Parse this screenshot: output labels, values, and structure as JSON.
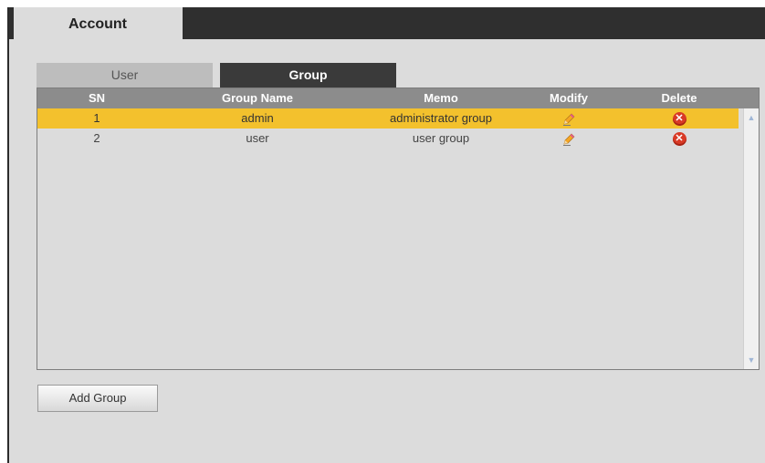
{
  "header": {
    "account_tab": "Account"
  },
  "subtabs": {
    "user": "User",
    "group": "Group"
  },
  "table": {
    "columns": {
      "sn": "SN",
      "group_name": "Group Name",
      "memo": "Memo",
      "modify": "Modify",
      "delete": "Delete"
    },
    "rows": [
      {
        "sn": "1",
        "group_name": "admin",
        "memo": "administrator group",
        "selected": true
      },
      {
        "sn": "2",
        "group_name": "user",
        "memo": "user group",
        "selected": false
      }
    ]
  },
  "icons": {
    "modify": "pencil-icon",
    "delete": "delete-x-icon",
    "scroll_up": "arrow-up-icon",
    "scroll_down": "arrow-down-icon"
  },
  "colors": {
    "selected_row": "#f3c12d",
    "header_bar": "#2f2f2f",
    "active_tab": "#3a3a3a",
    "delete_icon": "#d93a26"
  },
  "buttons": {
    "add_group": "Add Group"
  }
}
